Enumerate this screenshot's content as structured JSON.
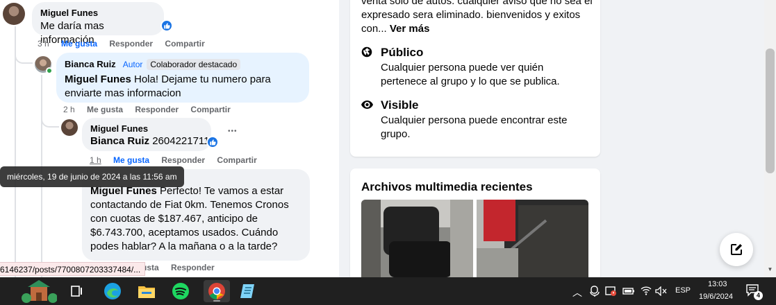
{
  "comments": {
    "c1": {
      "author": "Miguel Funes",
      "text": "Me daría mas información",
      "time": "3 h",
      "like": "Me gusta",
      "reply": "Responder",
      "share": "Compartir"
    },
    "c2": {
      "author": "Bianca Ruiz",
      "badge_author": "Autor",
      "badge_contributor": "Colaborador destacado",
      "mention": "Miguel Funes",
      "text": " Hola! Dejame tu numero para enviarte mas informacion",
      "time": "2 h",
      "like": "Me gusta",
      "reply": "Responder",
      "share": "Compartir"
    },
    "c3": {
      "author": "Miguel Funes",
      "mention": "Bianca Ruiz",
      "text": " 2604221711",
      "time": "1 h",
      "like": "Me gusta",
      "reply": "Responder",
      "share": "Compartir",
      "more": "•••"
    },
    "c4": {
      "mention": "Miguel Funes",
      "text": " Perfecto! Te vamos a estar contactando de Fiat 0km. Tenemos Cronos con cuotas de $187.467, anticipo de $6.743.700, aceptamos usados. Cuándo podes hablar? A la mañana o a la tarde?",
      "like_partial": "usta",
      "reply": "Responder"
    }
  },
  "tooltip": "miércoles, 19 de junio de 2024 a las 11:56 am",
  "status_url": "6146237/posts/7700807203337484/...",
  "about": {
    "description": "venta solo de autos. cualquier aviso que no sea el expresado sera eliminado. bienvenidos y exitos con...",
    "see_more": "Ver más",
    "public_title": "Público",
    "public_desc": "Cualquier persona puede ver quién pertenece al grupo y lo que se publica.",
    "visible_title": "Visible",
    "visible_desc": "Cualquier persona puede encontrar este grupo."
  },
  "media": {
    "title": "Archivos multimedia recientes"
  },
  "taskbar": {
    "language": "ESP",
    "time": "13:03",
    "date": "19/6/2024",
    "notifications": "4"
  },
  "colors": {
    "accent": "#0866ff",
    "like_blue": "#1b74e4",
    "taskbar": "#202020"
  }
}
